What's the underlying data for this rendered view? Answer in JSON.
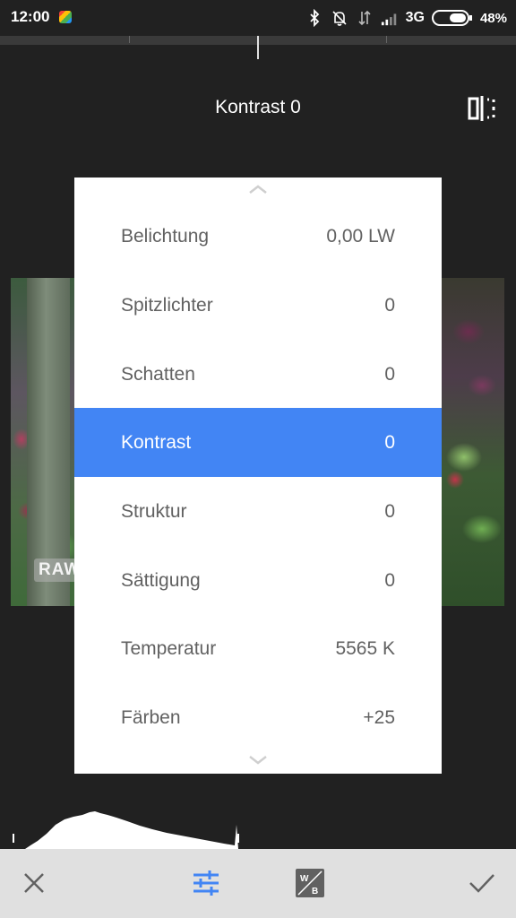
{
  "status_bar": {
    "time": "12:00",
    "network": "3G",
    "battery": "48%",
    "icons": [
      "app-icon",
      "bluetooth-icon",
      "notifications-off-icon",
      "data-arrows-icon",
      "signal-icon",
      "battery-icon"
    ]
  },
  "header": {
    "title": "Kontrast 0",
    "compare_icon": "compare-icon"
  },
  "preview": {
    "raw_badge": "RAW"
  },
  "menu": {
    "items": [
      {
        "label": "Belichtung",
        "value": "0,00 LW",
        "selected": false
      },
      {
        "label": "Spitzlichter",
        "value": "0",
        "selected": false
      },
      {
        "label": "Schatten",
        "value": "0",
        "selected": false
      },
      {
        "label": "Kontrast",
        "value": "0",
        "selected": true
      },
      {
        "label": "Struktur",
        "value": "0",
        "selected": false
      },
      {
        "label": "Sättigung",
        "value": "0",
        "selected": false
      },
      {
        "label": "Temperatur",
        "value": "5565 K",
        "selected": false
      },
      {
        "label": "Färben",
        "value": "+25",
        "selected": false
      }
    ],
    "scroll_up_icon": "chevron-up-icon",
    "scroll_down_icon": "chevron-down-icon"
  },
  "toolbar": {
    "cancel_icon": "close-icon",
    "adjust_icon": "sliders-icon",
    "white_balance_icon": "white-balance-icon",
    "apply_icon": "check-icon"
  },
  "colors": {
    "background": "#212121",
    "accent": "#4285f4",
    "panel": "#ffffff",
    "toolbar": "#e0e0e0",
    "text_muted": "#616161"
  }
}
